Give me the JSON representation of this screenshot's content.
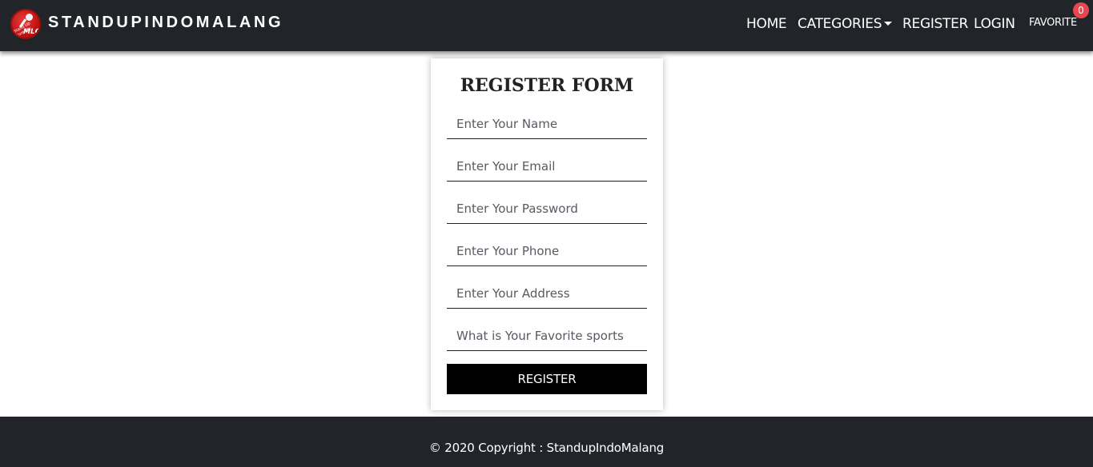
{
  "navbar": {
    "brand": "STANDUPINDOMALANG",
    "logo_text": "MLG",
    "logo_small_text": "Stand Up Comedy",
    "links": {
      "home": "HOME",
      "categories": "CATEGORIES",
      "register": "REGISTER",
      "login": "LOGIN"
    },
    "favorite_label": "FAVORITE",
    "favorite_count": "0"
  },
  "form": {
    "title": "REGISTER FORM",
    "fields": {
      "name": "Enter Your Name",
      "email": "Enter Your Email",
      "password": "Enter Your Password",
      "phone": "Enter Your Phone",
      "address": "Enter Your Address",
      "sports": "What is Your Favorite sports"
    },
    "submit_label": "REGISTER"
  },
  "footer": {
    "copyright": "© 2020 Copyright :  StandupIndoMalang"
  },
  "colors": {
    "navbar_bg": "#212529",
    "badge": "#e8474f",
    "button": "#000000",
    "logo": "#c41414"
  }
}
